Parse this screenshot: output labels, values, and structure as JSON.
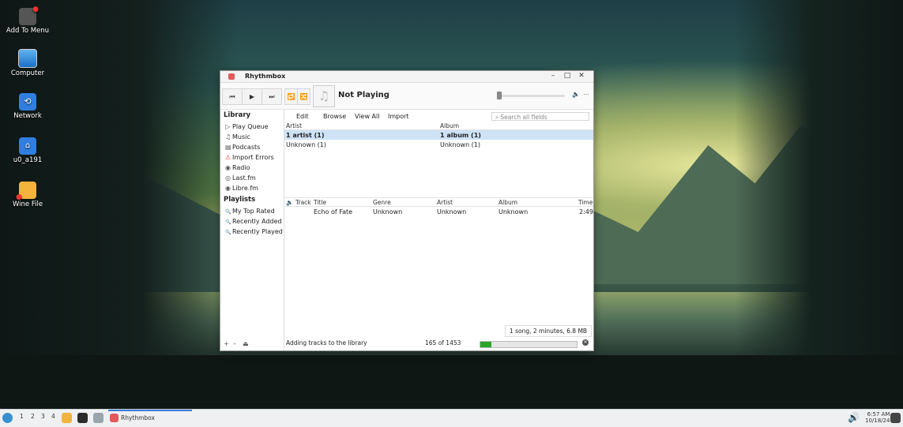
{
  "desktop": {
    "icons": [
      {
        "label": "Add To Menu"
      },
      {
        "label": "Computer"
      },
      {
        "label": "Network"
      },
      {
        "label": "u0_a191"
      },
      {
        "label": "Wine File"
      }
    ]
  },
  "window": {
    "title": "Rhythmbox",
    "controls": {
      "minimize": "–",
      "maximize": "□",
      "close": "✕"
    }
  },
  "toolbar": {
    "prev": "⏮",
    "play": "▶",
    "next": "⏭",
    "repeat": "🔁",
    "shuffle": "🔀",
    "now_playing": "Not Playing",
    "art_placeholder": "♫",
    "volume_icon": "🔈",
    "menu_icon": "⋯",
    "seek_fraction": 0.0
  },
  "sidebar": {
    "library_header": "Library",
    "library_items": [
      {
        "icon": "▷",
        "label": "Play Queue"
      },
      {
        "icon": "♫",
        "label": "Music"
      },
      {
        "icon": "▤",
        "label": "Podcasts"
      },
      {
        "icon": "⚠",
        "label": "Import Errors"
      },
      {
        "icon": "◉",
        "label": "Radio"
      },
      {
        "icon": "◎",
        "label": "Last.fm"
      },
      {
        "icon": "◉",
        "label": "Libre.fm"
      }
    ],
    "playlists_header": "Playlists",
    "playlist_items": [
      {
        "icon": "🔍",
        "label": "My Top Rated"
      },
      {
        "icon": "🔍",
        "label": "Recently Added"
      },
      {
        "icon": "🔍",
        "label": "Recently Played"
      }
    ],
    "bottom": {
      "add": "+",
      "remove": "–",
      "eject": "⏏"
    }
  },
  "menu": {
    "edit": "Edit",
    "browse": "Browse",
    "view_all": "View All",
    "import": "Import"
  },
  "search": {
    "placeholder": "Search all fields"
  },
  "browser": {
    "artist_header": "Artist",
    "album_header": "Album",
    "rows": [
      {
        "artist": "1 artist (1)",
        "album": "1 album (1)",
        "selected": true
      },
      {
        "artist": "Unknown (1)",
        "album": "Unknown (1)",
        "selected": false
      }
    ]
  },
  "tracks": {
    "headers": {
      "playing": "🔈",
      "track": "Track",
      "title": "Title",
      "genre": "Genre",
      "artist": "Artist",
      "album": "Album",
      "time": "Time"
    },
    "rows": [
      {
        "track": "",
        "title": "Echo of Fate",
        "genre": "Unknown",
        "artist": "Unknown",
        "album": "Unknown",
        "time": "2:49"
      }
    ]
  },
  "summary": "1 song, 2 minutes, 6.8 MB",
  "status": {
    "message": "Adding tracks to the library",
    "count": "165 of 1453",
    "progress": 0.114
  },
  "taskbar": {
    "workspaces": [
      "1",
      "2",
      "3",
      "4"
    ],
    "app_label": "Rhythmbox",
    "time": "6:57 AM",
    "date": "10/18/24"
  }
}
